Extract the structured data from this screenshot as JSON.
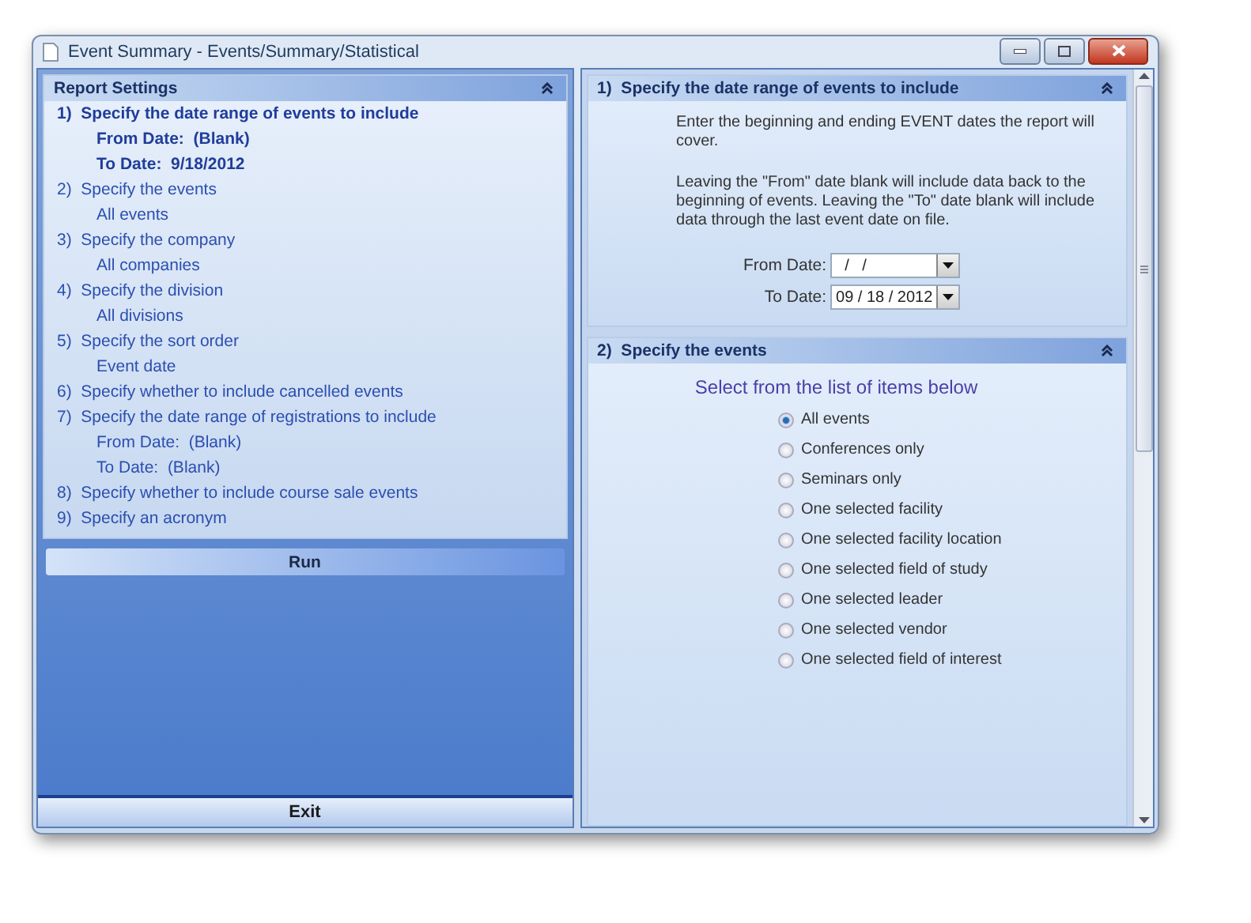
{
  "window": {
    "title": "Event Summary - Events/Summary/Statistical"
  },
  "report_settings": {
    "title": "Report Settings",
    "steps": [
      {
        "label": "1)  Specify the date range of events to include",
        "selected": true,
        "children": [
          {
            "label": "From Date:  (Blank)"
          },
          {
            "label": "To Date:  9/18/2012"
          }
        ]
      },
      {
        "label": "2)  Specify the events",
        "selected": false,
        "children": [
          {
            "label": "All events"
          }
        ]
      },
      {
        "label": "3)  Specify the company",
        "selected": false,
        "children": [
          {
            "label": "All companies"
          }
        ]
      },
      {
        "label": "4)  Specify the division",
        "selected": false,
        "children": [
          {
            "label": "All divisions"
          }
        ]
      },
      {
        "label": "5)  Specify the sort order",
        "selected": false,
        "children": [
          {
            "label": "Event date"
          }
        ]
      },
      {
        "label": "6)  Specify whether to include cancelled events",
        "selected": false
      },
      {
        "label": "7)  Specify the date range of registrations to include",
        "selected": false,
        "children": [
          {
            "label": "From Date:  (Blank)"
          },
          {
            "label": "To Date:  (Blank)"
          }
        ]
      },
      {
        "label": "8)  Specify whether to include course sale events",
        "selected": false
      },
      {
        "label": "9)  Specify an acronym",
        "selected": false
      }
    ]
  },
  "run_button": "Run",
  "exit_button": "Exit",
  "sections": [
    {
      "kind": "date_range",
      "title": "1)  Specify the date range of events to include",
      "paragraphs": [
        "Enter the beginning and ending EVENT dates the report will cover.",
        "Leaving the \"From\" date blank will include data back to the beginning of events. Leaving the \"To\" date blank will include data through the last event date on file."
      ],
      "fields": [
        {
          "label": "From Date:",
          "value": "  /   /"
        },
        {
          "label": "To Date:",
          "value": "09 / 18 / 2012"
        }
      ]
    },
    {
      "kind": "options",
      "title": "2)  Specify the events",
      "prompt": "Select from the list of items below",
      "options": [
        {
          "label": "All events",
          "selected": true
        },
        {
          "label": "Conferences only",
          "selected": false
        },
        {
          "label": "Seminars only",
          "selected": false
        },
        {
          "label": "One selected facility",
          "selected": false
        },
        {
          "label": "One selected facility location",
          "selected": false
        },
        {
          "label": "One selected field of study",
          "selected": false
        },
        {
          "label": "One selected leader",
          "selected": false
        },
        {
          "label": "One selected vendor",
          "selected": false
        },
        {
          "label": "One selected field of interest",
          "selected": false
        }
      ]
    }
  ]
}
